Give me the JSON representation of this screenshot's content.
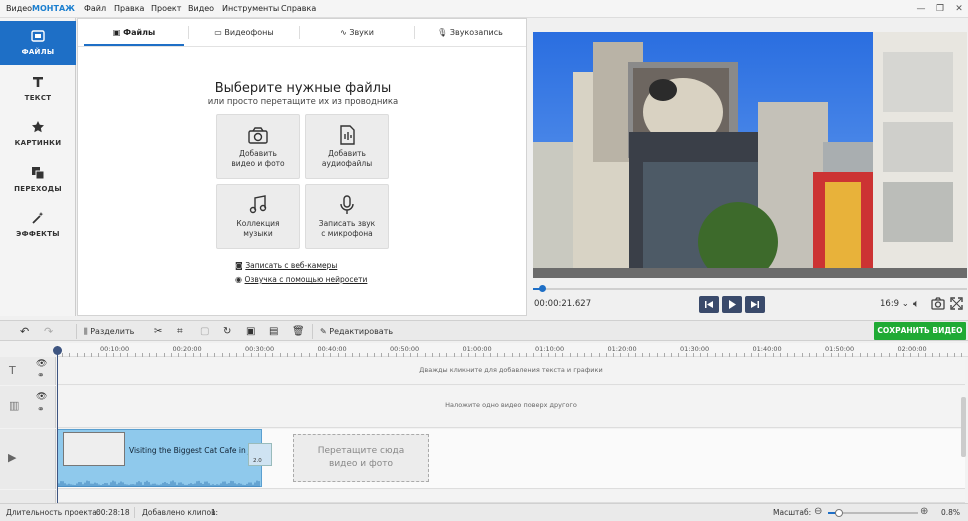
{
  "app": {
    "logo_prefix": "Видео",
    "logo_suffix": "МОНТАЖ",
    "menu": [
      "Файл",
      "Правка",
      "Проект",
      "Видео",
      "Инструменты",
      "Справка"
    ]
  },
  "sidebar": {
    "items": [
      {
        "label": "ФАЙЛЫ",
        "icon": "files-icon",
        "active": true
      },
      {
        "label": "ТЕКСТ",
        "icon": "text-icon",
        "active": false
      },
      {
        "label": "КАРТИНКИ",
        "icon": "star-icon",
        "active": false
      },
      {
        "label": "ПЕРЕХОДЫ",
        "icon": "transitions-icon",
        "active": false
      },
      {
        "label": "ЭФФЕКТЫ",
        "icon": "wand-icon",
        "active": false
      }
    ]
  },
  "panel": {
    "tabs": [
      "Файлы",
      "Видеофоны",
      "Звуки",
      "Звукозапись"
    ],
    "heading": "Выберите нужные файлы",
    "subheading": "или просто перетащите их из проводника",
    "buttons": [
      {
        "line1": "Добавить",
        "line2": "видео и фото"
      },
      {
        "line1": "Добавить",
        "line2": "аудиофайлы"
      },
      {
        "line1": "Коллекция",
        "line2": "музыки"
      },
      {
        "line1": "Записать звук",
        "line2": "с микрофона"
      }
    ],
    "links": [
      "Записать с веб-камеры",
      "Озвучка с помощью нейросети"
    ]
  },
  "player": {
    "timecode": "00:00:21.627",
    "aspect": "16:9",
    "progress_fraction": 0.02
  },
  "toolbar": {
    "split_label": "Разделить",
    "edit_label": "Редактировать",
    "save_label": "СОХРАНИТЬ ВИДЕО"
  },
  "ruler": [
    "00:10:00",
    "00:20:00",
    "00:30:00",
    "00:40:00",
    "00:50:00",
    "01:00:00",
    "01:10:00",
    "01:20:00",
    "01:30:00",
    "01:40:00",
    "01:50:00",
    "02:00:00"
  ],
  "timeline": {
    "text_hint": "Дважды кликните для добавления текста и графики",
    "overlay_hint": "Наложите одно видео поверх другого",
    "clip_title": "Visiting the Biggest Cat Cafe in Japa",
    "clip_badge": "2.0",
    "drop_line1": "Перетащите сюда",
    "drop_line2": "видео и фото"
  },
  "status": {
    "duration_label": "Длительность проекта:",
    "duration_value": "00:28:18",
    "clips_label": "Добавлено клипов:",
    "clips_value": "1",
    "zoom_label": "Масштаб:",
    "zoom_value": "0.8%",
    "zoom_fraction": 0.12
  },
  "colors": {
    "accent": "#1e6fc6",
    "save": "#1faa34",
    "clip": "#8fc9ec"
  }
}
